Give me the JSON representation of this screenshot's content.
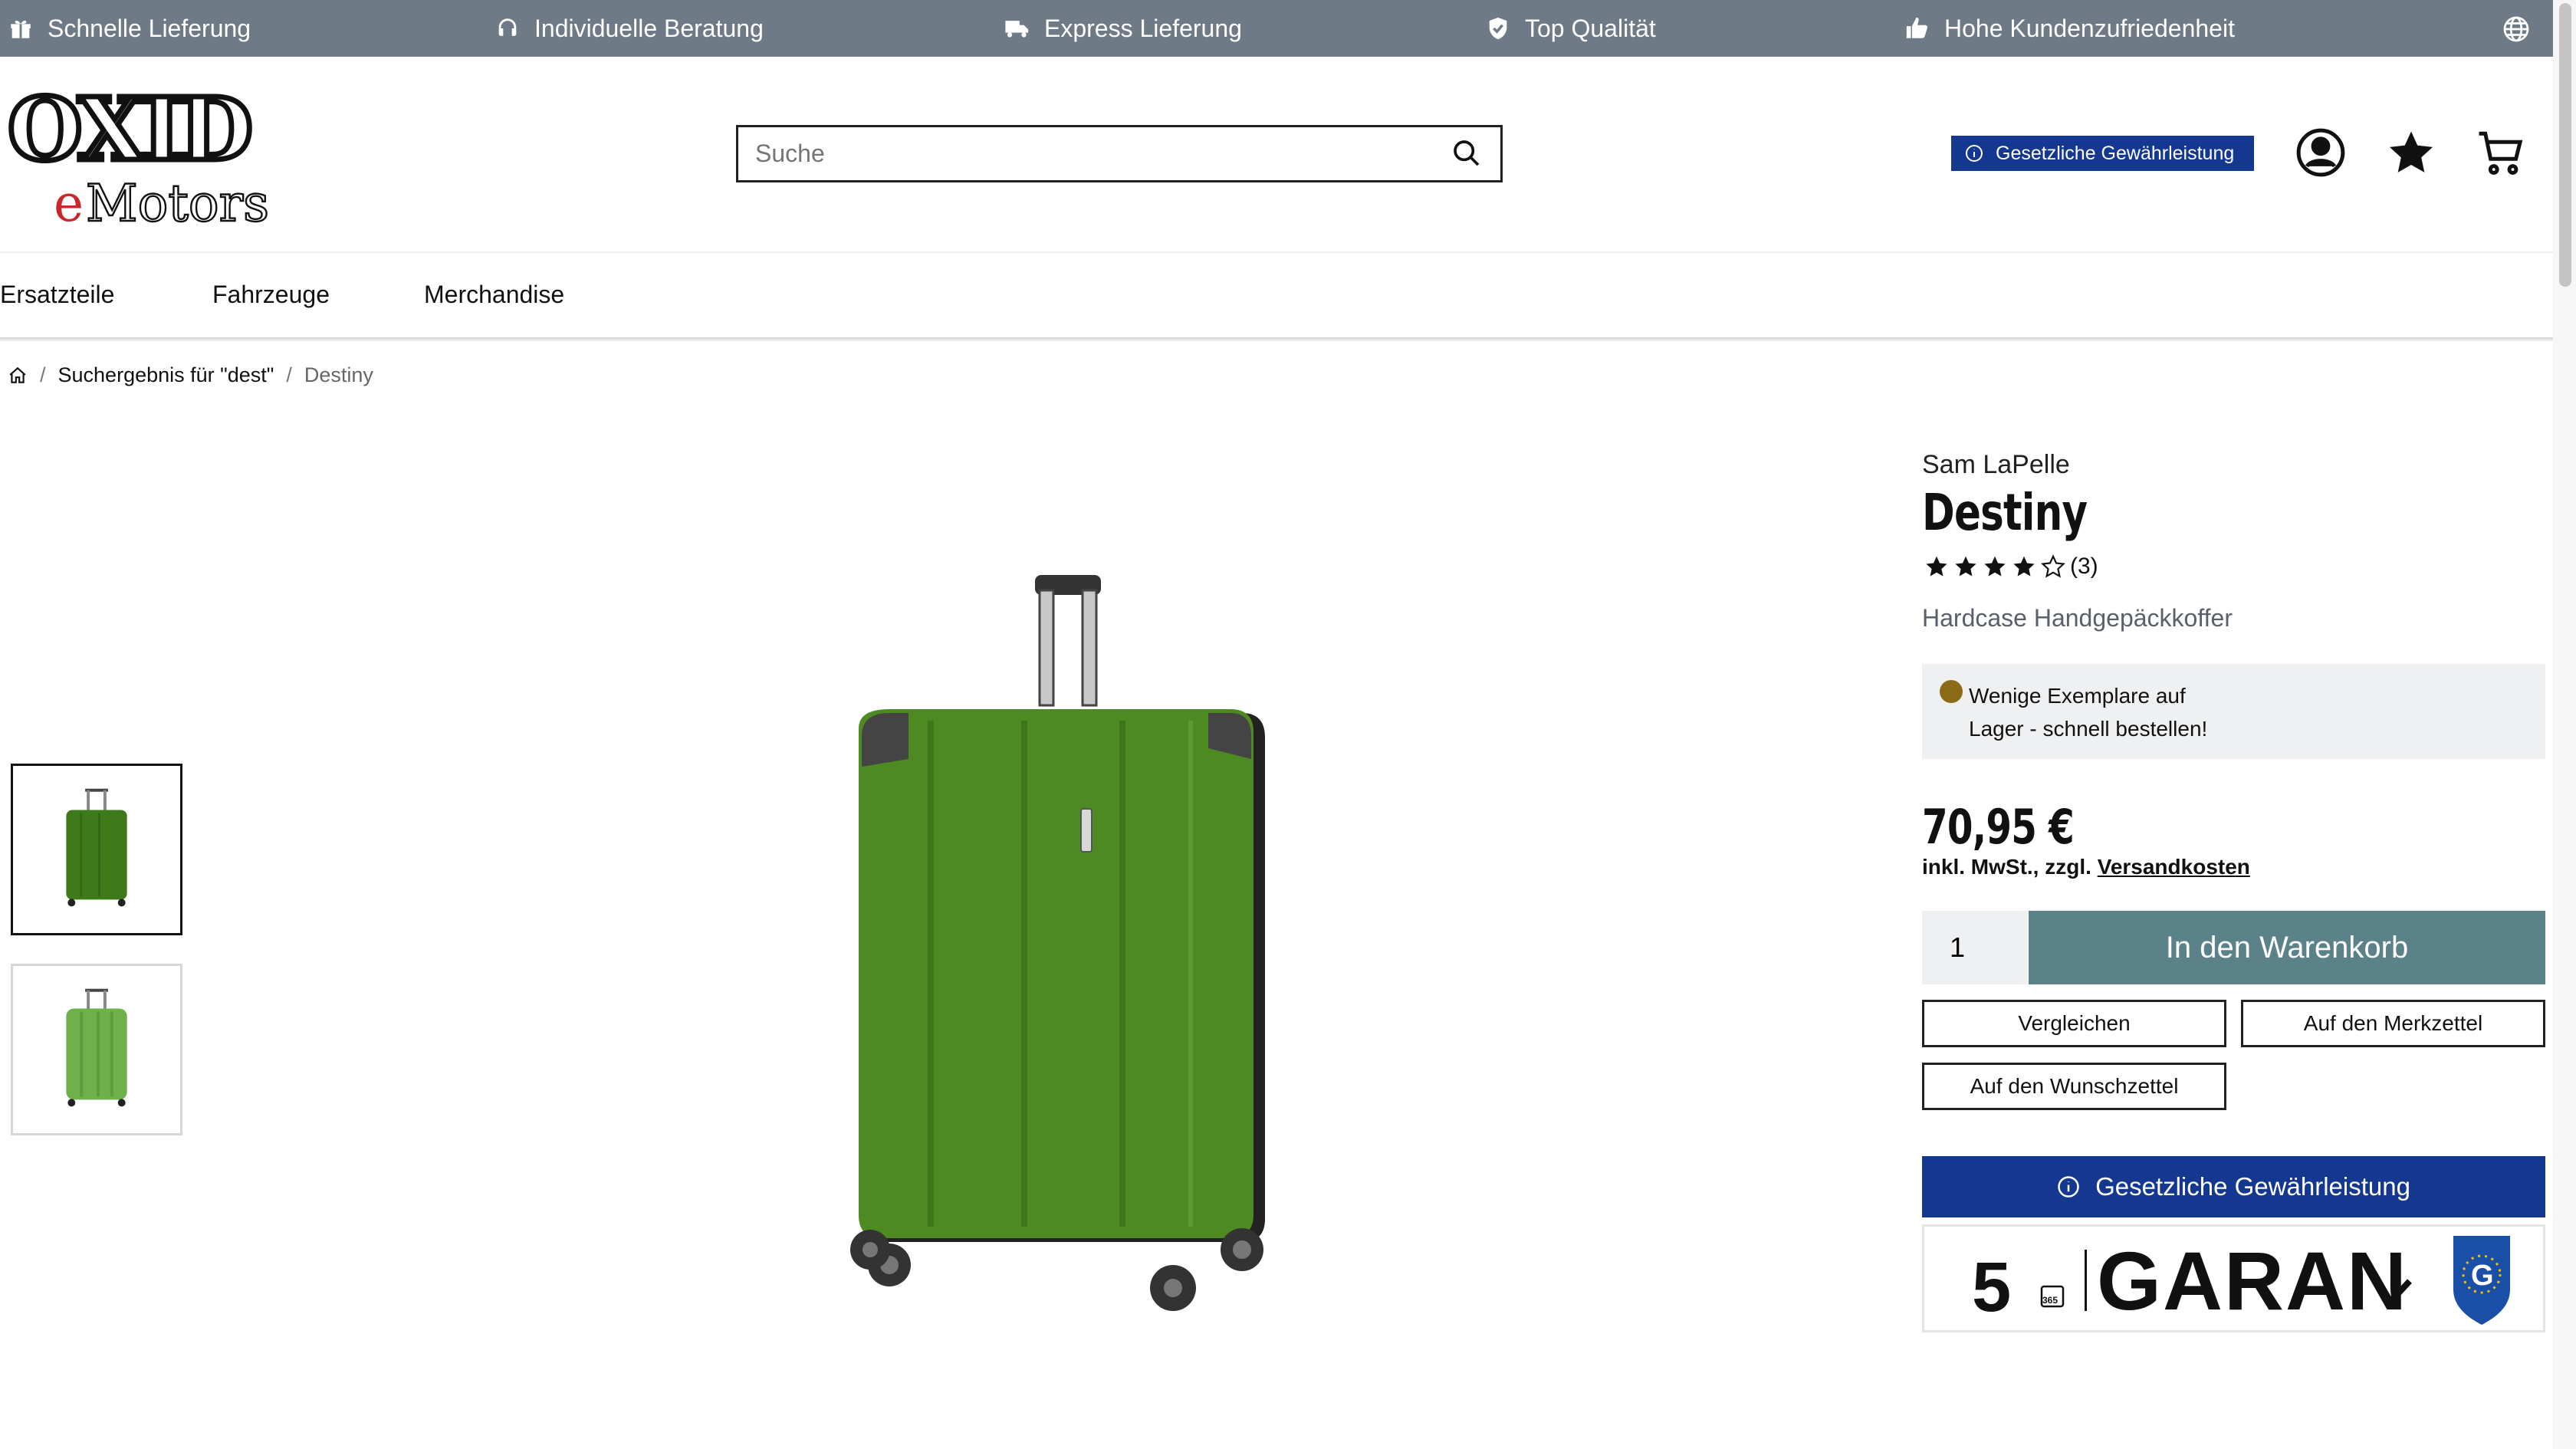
{
  "topbar": {
    "items": [
      {
        "label": "Schnelle Lieferung",
        "icon": "gift-icon"
      },
      {
        "label": "Individuelle Beratung",
        "icon": "headset-icon"
      },
      {
        "label": "Express Lieferung",
        "icon": "truck-icon"
      },
      {
        "label": "Top Qualität",
        "icon": "shield-check-icon"
      },
      {
        "label": "Hohe Kundenzufriedenheit",
        "icon": "thumbs-up-icon"
      }
    ],
    "language_icon": "globe-icon"
  },
  "logo": {
    "line1": "OXID",
    "line2_accent": "e",
    "line2_rest": "Motors"
  },
  "search": {
    "placeholder": "Suche"
  },
  "header": {
    "warranty_badge": "Gesetzliche Gewährleistung"
  },
  "nav": {
    "items": [
      "Ersatzteile",
      "Fahrzeuge",
      "Merchandise"
    ]
  },
  "breadcrumb": {
    "search_result": "Suchergebnis für \"dest\"",
    "current": "Destiny"
  },
  "product": {
    "brand": "Sam LaPelle",
    "title": "Destiny",
    "rating": 4,
    "rating_max": 5,
    "review_count": "(3)",
    "subtitle": "Hardcase Handgepäckkoffer",
    "stock_text": "Wenige Exemplare auf Lager - schnell bestellen!",
    "stock_color": "#8b6b16",
    "price": "70,95 €",
    "tax_prefix": "inkl. MwSt., zzgl. ",
    "shipping_link": "Versandkosten",
    "quantity": "1",
    "add_to_cart": "In den Warenkorb",
    "compare": "Vergleichen",
    "notepad": "Auf den Merkzettel",
    "wishlist": "Auf den Wunschzettel",
    "warranty_bar": "Gesetzliche Gewährleistung",
    "garant_number": "5",
    "garant_word": "GARAN",
    "garant_days": "365"
  },
  "colors": {
    "topbar": "#6e7b87",
    "brand_blue": "#14388f",
    "cart_button": "#5b8288",
    "suitcase_green": "#4e8a22"
  }
}
